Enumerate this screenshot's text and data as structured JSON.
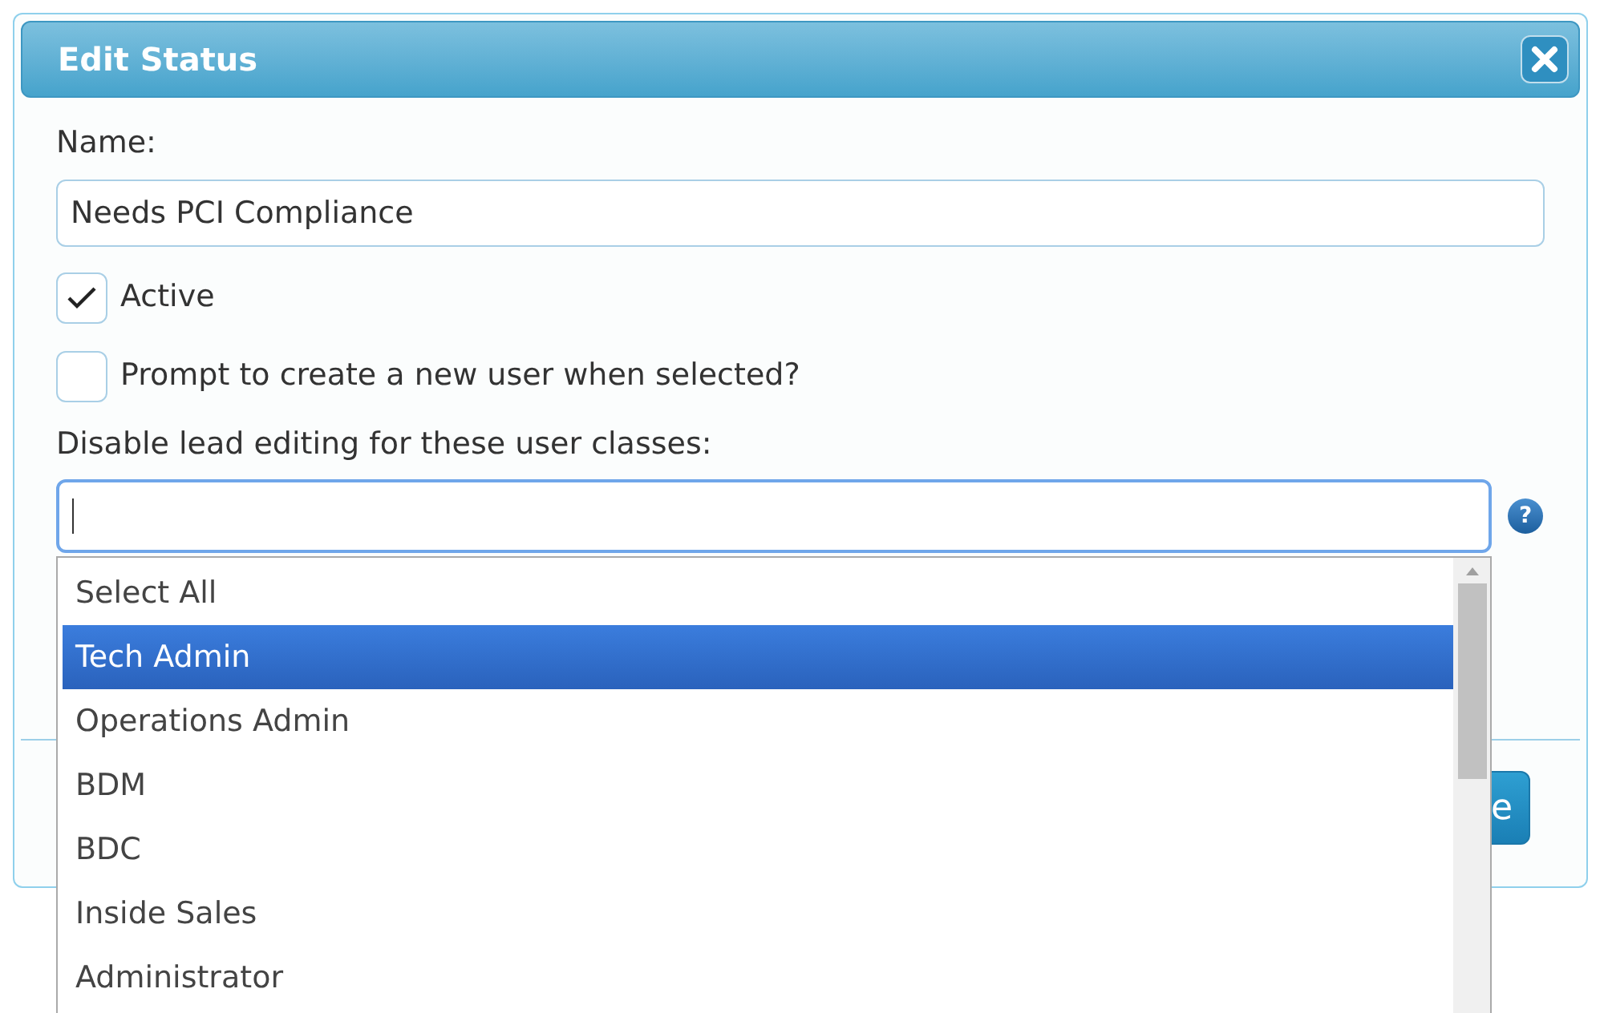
{
  "dialog": {
    "title": "Edit Status"
  },
  "name_field": {
    "label": "Name:",
    "value": "Needs PCI Compliance"
  },
  "checkboxes": [
    {
      "label": "Active",
      "checked": true
    },
    {
      "label": "Prompt to create a new user when selected?",
      "checked": false
    }
  ],
  "user_classes": {
    "label": "Disable lead editing for these user classes:",
    "expanded": true,
    "options": [
      {
        "label": "Select All",
        "selected": false
      },
      {
        "label": "Tech Admin",
        "selected": true
      },
      {
        "label": "Operations Admin",
        "selected": false
      },
      {
        "label": "BDM",
        "selected": false
      },
      {
        "label": "BDC",
        "selected": false
      },
      {
        "label": "Inside Sales",
        "selected": false
      },
      {
        "label": "Administrator",
        "selected": false
      }
    ]
  },
  "help_button": {
    "label": "?"
  },
  "footer_button": {
    "label": "e"
  }
}
